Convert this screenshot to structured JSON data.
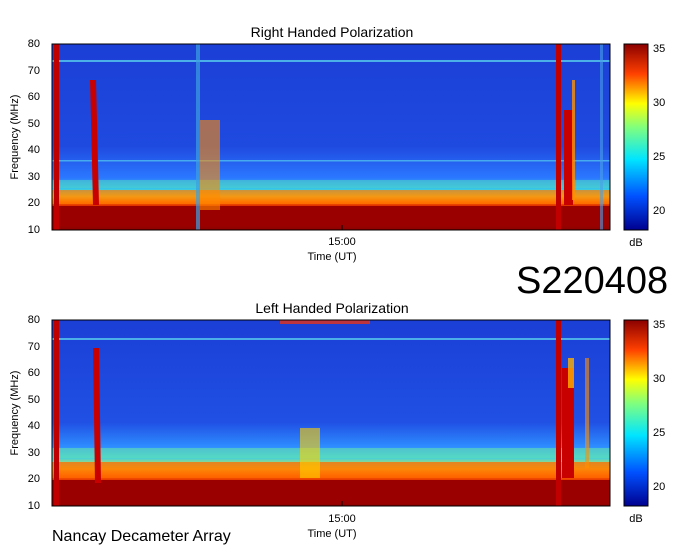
{
  "chart_data": [
    {
      "type": "heatmap",
      "title": "Right Handed Polarization",
      "xlabel": "Time (UT)",
      "ylabel": "Frequency (MHz)",
      "ylim": [
        10,
        80
      ],
      "yticks": [
        10,
        20,
        30,
        40,
        50,
        60,
        70,
        80
      ],
      "xticks": [
        "15:00"
      ],
      "colorbar": {
        "label": "dB",
        "range": [
          18,
          35
        ],
        "ticks": [
          20,
          25,
          30,
          35
        ]
      },
      "features": [
        {
          "name": "noise/RFI band",
          "freq_range_mhz": [
            10,
            20
          ],
          "level_db": 35
        },
        {
          "name": "enhanced band",
          "freq_range_mhz": [
            20,
            28
          ],
          "level_db": 29
        },
        {
          "name": "background",
          "freq_range_mhz": [
            28,
            80
          ],
          "level_db": 20
        },
        {
          "name": "burst",
          "freq_range_mhz": [
            10,
            80
          ],
          "level_db": 35
        }
      ]
    },
    {
      "type": "heatmap",
      "title": "Left Handed Polarization",
      "xlabel": "Time (UT)",
      "ylabel": "Frequency (MHz)",
      "ylim": [
        10,
        80
      ],
      "yticks": [
        10,
        20,
        30,
        40,
        50,
        60,
        70,
        80
      ],
      "xticks": [
        "15:00"
      ],
      "colorbar": {
        "label": "dB",
        "range": [
          18,
          35
        ],
        "ticks": [
          20,
          25,
          30,
          35
        ]
      },
      "features": [
        {
          "name": "noise/RFI band",
          "freq_range_mhz": [
            10,
            20
          ],
          "level_db": 35
        },
        {
          "name": "enhanced band",
          "freq_range_mhz": [
            20,
            30
          ],
          "level_db": 30
        },
        {
          "name": "background",
          "freq_range_mhz": [
            30,
            80
          ],
          "level_db": 20
        },
        {
          "name": "burst",
          "freq_range_mhz": [
            10,
            80
          ],
          "level_db": 35
        }
      ]
    }
  ],
  "event_id": "S220408",
  "footer": "Nancay Decameter Array",
  "colors": {
    "low": "#00008f",
    "mid_low": "#0064ff",
    "mid": "#00e5ff",
    "mid_high": "#ffff00",
    "high": "#ff5000",
    "max": "#8b0000"
  }
}
